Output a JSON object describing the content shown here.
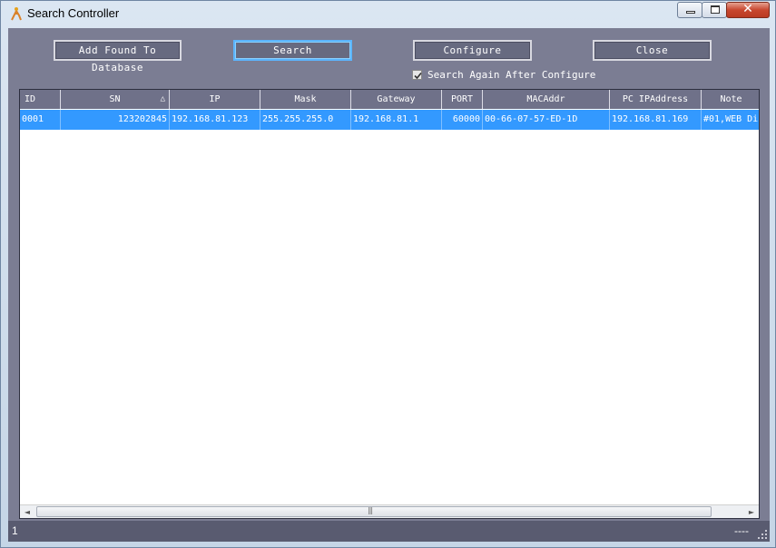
{
  "window": {
    "title": "Search Controller",
    "close_glyph": "✕"
  },
  "toolbar": {
    "add_label": "Add Found To Database",
    "search_label": "Search",
    "configure_label": "Configure",
    "close_label": "Close",
    "search_again_label": "Search Again After Configure",
    "search_again_checked": true
  },
  "table": {
    "columns": [
      "ID",
      "SN",
      "IP",
      "Mask",
      "Gateway",
      "PORT",
      "MACAddr",
      "PC IPAddress",
      "Note"
    ],
    "sort_indicator": "△",
    "rows": [
      [
        "0001",
        "123202845",
        "192.168.81.123",
        "255.255.255.0",
        "192.168.81.1",
        "60000",
        "00-66-07-57-ED-1D",
        "192.168.81.169",
        "#01,WEB Di"
      ]
    ]
  },
  "scrollbar": {
    "left_arrow": "◄",
    "right_arrow": "►",
    "grip": "|||"
  },
  "status": {
    "left": "1",
    "right": "----"
  },
  "icons": [
    "app-icon",
    "minimize-icon",
    "maximize-icon",
    "close-icon",
    "sort-ascending-icon",
    "checkmark-icon",
    "resize-grip-icon"
  ],
  "colors": {
    "selection": "#3399ff",
    "panel": "#7b7d93",
    "header": "#6f7189",
    "button": "#676a80",
    "active_border": "#5bb5ff"
  }
}
